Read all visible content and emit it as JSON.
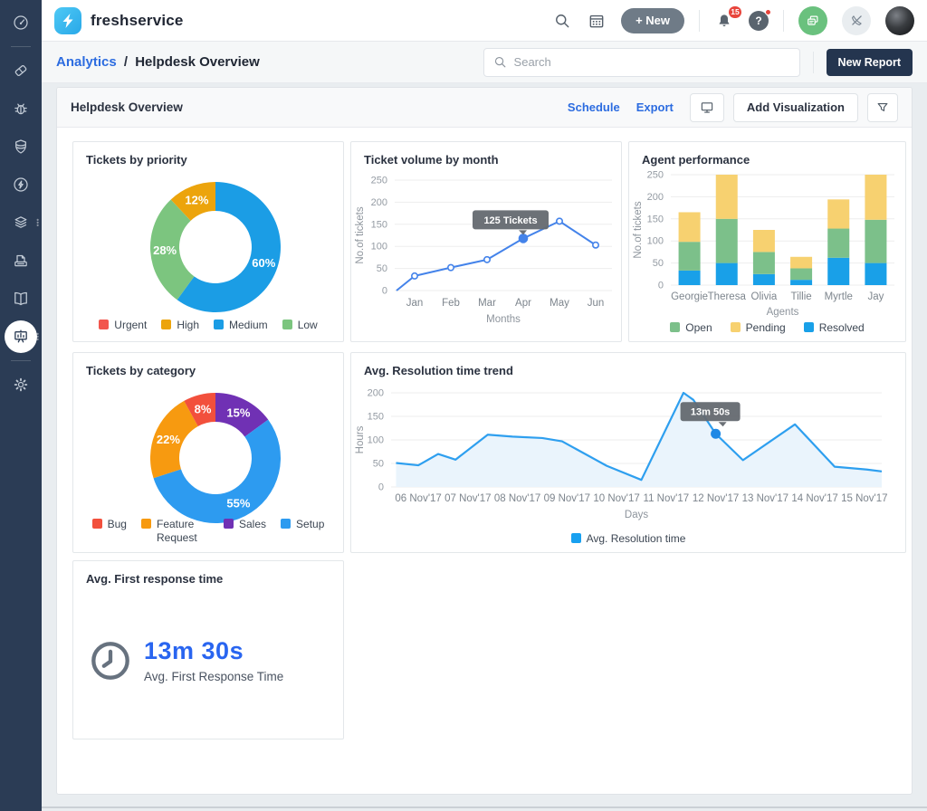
{
  "brand": {
    "name": "freshservice"
  },
  "header": {
    "new_button_label": "+ New",
    "notification_badge": "15",
    "help_glyph": "?"
  },
  "breadcrumb": {
    "link": "Analytics",
    "separator": "/",
    "current": "Helpdesk Overview"
  },
  "searchbar": {
    "placeholder": "Search"
  },
  "toolbar": {
    "new_report_label": "New Report"
  },
  "report_header": {
    "title": "Helpdesk Overview",
    "schedule_label": "Schedule",
    "export_label": "Export",
    "add_visualization_label": "Add Visualization"
  },
  "colors": {
    "sidebar_bg": "#2b3c55",
    "link_blue": "#2c6ce0",
    "kpi_blue": "#2965f0",
    "tooltip_bg": "#646970"
  },
  "chart_data": [
    {
      "type": "pie",
      "title": "Tickets by priority",
      "slices": [
        {
          "label": "Medium",
          "value": 60,
          "pct_label": "60%",
          "color": "#1b9de5"
        },
        {
          "label": "Low",
          "value": 28,
          "pct_label": "28%",
          "color": "#7cc57f"
        },
        {
          "label": "High",
          "value": 12,
          "pct_label": "12%",
          "color": "#eca40c"
        }
      ],
      "legend": [
        {
          "label": "Urgent",
          "color": "#f2564d"
        },
        {
          "label": "High",
          "color": "#eca40c"
        },
        {
          "label": "Medium",
          "color": "#1b9de5"
        },
        {
          "label": "Low",
          "color": "#7cc57f"
        }
      ]
    },
    {
      "type": "line",
      "title": "Ticket volume by month",
      "xlabel": "Months",
      "ylabel": "No.of tickets",
      "ylim": [
        0,
        250
      ],
      "yticks": [
        0,
        50,
        100,
        150,
        200,
        250
      ],
      "categories": [
        "Jan",
        "Feb",
        "Mar",
        "Apr",
        "May",
        "Jun"
      ],
      "values": [
        33,
        52,
        70,
        118,
        157,
        103
      ],
      "line_starts_at_zero": true,
      "highlight_index": 3,
      "tooltip": {
        "text": "125 Tickets"
      },
      "color": "#4483ea"
    },
    {
      "type": "bar",
      "title": "Agent performance",
      "xlabel": "Agents",
      "ylabel": "No.of tickets",
      "ylim": [
        0,
        250
      ],
      "yticks": [
        0,
        50,
        100,
        150,
        200,
        250
      ],
      "categories": [
        "Georgie",
        "Theresa",
        "Olivia",
        "Tillie",
        "Myrtle",
        "Jay"
      ],
      "series": [
        {
          "name": "Resolved",
          "color": "#19a0e8",
          "values": [
            33,
            50,
            25,
            12,
            62,
            50
          ]
        },
        {
          "name": "Open",
          "color": "#7cc08a",
          "values": [
            65,
            100,
            50,
            26,
            66,
            98
          ]
        },
        {
          "name": "Pending",
          "color": "#f7d170",
          "values": [
            67,
            100,
            50,
            26,
            66,
            102
          ]
        }
      ],
      "legend": [
        {
          "label": "Open",
          "color": "#7cc08a"
        },
        {
          "label": "Pending",
          "color": "#f7d170"
        },
        {
          "label": "Resolved",
          "color": "#19a0e8"
        }
      ]
    },
    {
      "type": "pie",
      "title": "Tickets by category",
      "slices": [
        {
          "label": "Sales",
          "value": 15,
          "pct_label": "15%",
          "color": "#7031b4"
        },
        {
          "label": "Setup",
          "value": 55,
          "pct_label": "55%",
          "color": "#2d9bf0"
        },
        {
          "label": "Feature Request",
          "value": 22,
          "pct_label": "22%",
          "color": "#f79a10"
        },
        {
          "label": "Bug",
          "value": 8,
          "pct_label": "8%",
          "color": "#f2503c"
        }
      ],
      "legend": [
        {
          "label": "Bug",
          "color": "#f2503c"
        },
        {
          "label": "Feature Request",
          "color": "#f79a10"
        },
        {
          "label": "Sales",
          "color": "#7031b4"
        },
        {
          "label": "Setup",
          "color": "#2d9bf0"
        }
      ]
    },
    {
      "type": "area",
      "title": "Avg. Resolution time trend",
      "xlabel": "Days",
      "ylabel": "Hours",
      "ylim": [
        0,
        200
      ],
      "yticks": [
        0,
        50,
        100,
        150,
        200
      ],
      "categories": [
        "06 Nov'17",
        "07 Nov'17",
        "08 Nov'17",
        "09 Nov'17",
        "10 Nov'17",
        "11 Nov'17",
        "12 Nov'17",
        "13 Nov'17",
        "14 Nov'17",
        "15 Nov'17"
      ],
      "x_domain": [
        5.45,
        15.35
      ],
      "points": [
        [
          5.55,
          51
        ],
        [
          6.0,
          46
        ],
        [
          6.4,
          70
        ],
        [
          6.75,
          58
        ],
        [
          7.4,
          111
        ],
        [
          7.9,
          107
        ],
        [
          8.5,
          104
        ],
        [
          8.9,
          97
        ],
        [
          9.8,
          45
        ],
        [
          10.5,
          15
        ],
        [
          11.35,
          200
        ],
        [
          11.55,
          185
        ],
        [
          12.0,
          113
        ],
        [
          12.55,
          57
        ],
        [
          13.6,
          133
        ],
        [
          14.4,
          43
        ],
        [
          15.05,
          37
        ],
        [
          15.35,
          33
        ]
      ],
      "tooltip": {
        "text": "13m 50s",
        "point": [
          12.0,
          113
        ]
      },
      "color": "#2e9fef",
      "fill": "#eaf4fc",
      "legend": [
        {
          "label": "Avg. Resolution time",
          "color": "#18a0f0"
        }
      ]
    },
    {
      "type": "kpi",
      "title": "Avg. First response time",
      "value": "13m 30s",
      "label": "Avg. First Response Time"
    }
  ]
}
